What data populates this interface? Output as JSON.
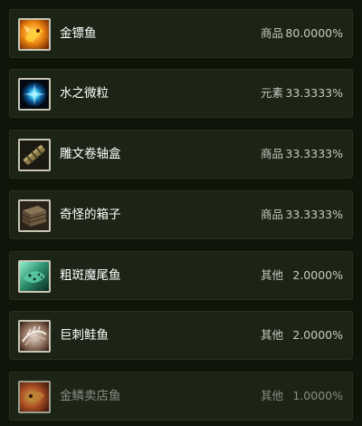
{
  "loot_list": {
    "items": [
      {
        "name": "金镖鱼",
        "type": "商品",
        "chance": "80.0000%",
        "icon": "goldfin-fish-icon"
      },
      {
        "name": "水之微粒",
        "type": "元素",
        "chance": "33.3333%",
        "icon": "mote-of-water-icon"
      },
      {
        "name": "雕文卷轴盒",
        "type": "商品",
        "chance": "33.3333%",
        "icon": "scroll-case-icon"
      },
      {
        "name": "奇怪的箱子",
        "type": "商品",
        "chance": "33.3333%",
        "icon": "strange-crate-icon"
      },
      {
        "name": "粗斑魔尾鱼",
        "type": "其他",
        "chance": "2.0000%",
        "icon": "spotted-fish-icon"
      },
      {
        "name": "巨刺鲑鱼",
        "type": "其他",
        "chance": "2.0000%",
        "icon": "spiny-salmon-icon"
      },
      {
        "name": "金鳞卖店鱼",
        "type": "其他",
        "chance": "1.0000%",
        "icon": "goldscale-fish-icon"
      }
    ]
  },
  "colors": {
    "background": "#0f1509",
    "row_background": "#1c2515",
    "name_text": "#ffffff",
    "secondary_text": "#c9c9c2",
    "faded_text": "#8a8c84"
  }
}
